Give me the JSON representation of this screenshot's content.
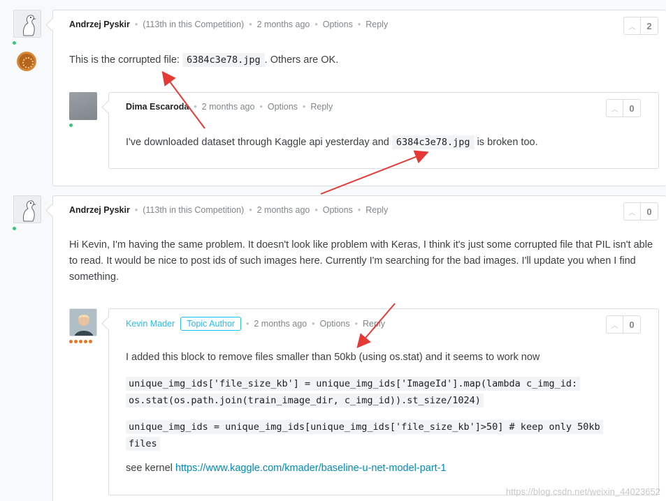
{
  "comments": [
    {
      "author": "Andrzej Pyskir",
      "rank": "(113th in this Competition)",
      "time": "2 months ago",
      "options": "Options",
      "reply": "Reply",
      "votes": "2",
      "text_before": "This is the corrupted file:",
      "code": "6384c3e78.jpg",
      "text_after": ". Others are OK."
    },
    {
      "author": "Dima Escaroda",
      "time": "2 months ago",
      "options": "Options",
      "reply": "Reply",
      "votes": "0",
      "text_before": "I've downloaded dataset through Kaggle api yesterday and",
      "code": "6384c3e78.jpg",
      "text_after": "is broken too."
    },
    {
      "author": "Andrzej Pyskir",
      "rank": "(113th in this Competition)",
      "time": "2 months ago",
      "options": "Options",
      "reply": "Reply",
      "votes": "0",
      "text": "Hi Kevin, I'm having the same problem. It doesn't look like problem with Keras, I think it's just some corrupted file that PIL isn't able to read. It would be nice to post ids of such images here. Currently I'm searching for the bad images. I'll update you when I find something."
    },
    {
      "author": "Kevin Mader",
      "badge": "Topic Author",
      "time": "2 months ago",
      "options": "Options",
      "reply": "Reply",
      "votes": "0",
      "text": "I added this block to remove files smaller than 50kb (using os.stat) and it seems to work now",
      "code1_line1": "unique_img_ids['file_size_kb'] = unique_img_ids['ImageId'].map(lambda c_img_id:",
      "code1_line2": "os.stat(os.path.join(train_image_dir, c_img_id)).st_size/1024)",
      "code2_line1": "unique_img_ids = unique_img_ids[unique_img_ids['file_size_kb']>50] # keep only 50kb",
      "code2_line2": "files",
      "kernel_prefix": "see kernel",
      "kernel_link": "https://www.kaggle.com/kmader/baseline-u-net-model-part-1"
    }
  ],
  "watermark": "https://blog.csdn.net/weixin_44023652",
  "colors": {
    "accent": "#20beff",
    "annotation_arrow": "#e53935",
    "link": "#008abc"
  }
}
